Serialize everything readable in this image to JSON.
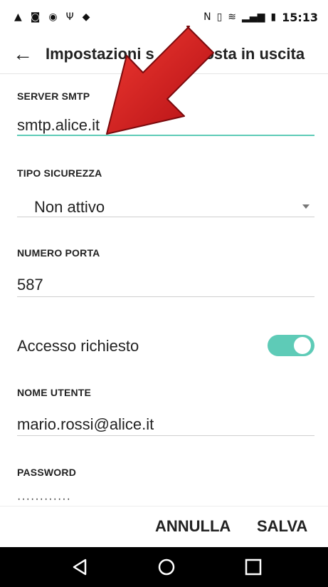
{
  "status_bar": {
    "left_icons": [
      "alarm-icon",
      "lock-icon",
      "signal-notify-icon",
      "usb-icon",
      "android-icon"
    ],
    "right_icons": [
      "nfc-icon",
      "vibrate-icon",
      "wifi-icon",
      "signal-icon",
      "battery-icon"
    ],
    "time": "15:13"
  },
  "app_bar": {
    "title_visible_left": "Impostazioni s",
    "title_visible_right": "Posta in uscita",
    "back_icon": "back-arrow-icon"
  },
  "form": {
    "smtp_server": {
      "label": "SERVER SMTP",
      "value": "smtp.alice.it"
    },
    "security_type": {
      "label": "TIPO SICUREZZA",
      "value": "Non attivo"
    },
    "port_number": {
      "label": "NUMERO PORTA",
      "value": "587"
    },
    "login_required": {
      "label": "Accesso richiesto",
      "enabled": true
    },
    "username": {
      "label": "NOME UTENTE",
      "value": "mario.rossi@alice.it"
    },
    "password": {
      "label": "PASSWORD",
      "value": "············"
    }
  },
  "actions": {
    "cancel_label": "ANNULLA",
    "save_label": "SALVA"
  },
  "navigation_bar": {
    "buttons": [
      "back-triangle-icon",
      "home-circle-icon",
      "recents-square-icon"
    ]
  },
  "colors": {
    "accent": "#5ecbb7",
    "overlay_arrow": "#d9141a"
  }
}
